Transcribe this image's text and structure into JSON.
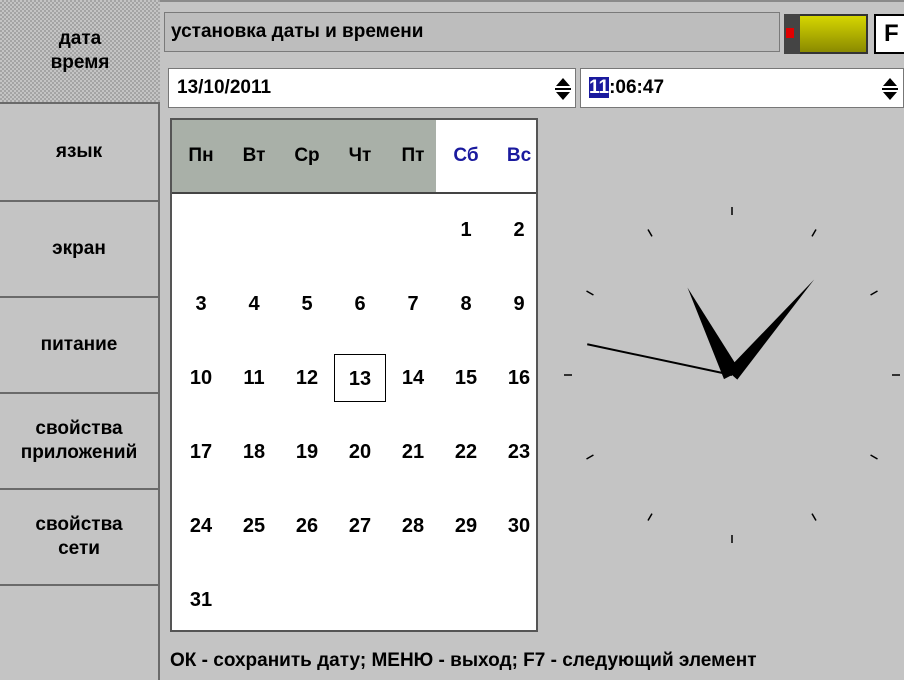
{
  "sidebar": {
    "items": [
      {
        "lines": [
          "дата",
          "время"
        ],
        "active": true
      },
      {
        "lines": [
          "язык"
        ]
      },
      {
        "lines": [
          "экран"
        ]
      },
      {
        "lines": [
          "питание"
        ]
      },
      {
        "lines": [
          "свойства",
          "приложений"
        ]
      },
      {
        "lines": [
          "свойства",
          "сети"
        ]
      }
    ]
  },
  "header": {
    "title": "установка даты и времени",
    "f_key": "F"
  },
  "date_input": {
    "value": "13/10/2011"
  },
  "time_input": {
    "hour": "11",
    "rest": ":06:47"
  },
  "calendar": {
    "weekdays": [
      "Пн",
      "Вт",
      "Ср",
      "Чт",
      "Пт",
      "Сб",
      "Вс"
    ],
    "weekend_color": "#1a1a9e",
    "weeks": [
      [
        "",
        "",
        "",
        "",
        "",
        "1",
        "2"
      ],
      [
        "3",
        "4",
        "5",
        "6",
        "7",
        "8",
        "9"
      ],
      [
        "10",
        "11",
        "12",
        "13",
        "14",
        "15",
        "16"
      ],
      [
        "17",
        "18",
        "19",
        "20",
        "21",
        "22",
        "23"
      ],
      [
        "24",
        "25",
        "26",
        "27",
        "28",
        "29",
        "30"
      ],
      [
        "31",
        "",
        "",
        "",
        "",
        "",
        ""
      ]
    ],
    "selected": "13"
  },
  "clock": {
    "hours": 11,
    "minutes": 6,
    "seconds": 47
  },
  "status": {
    "text": "ОК - сохранить дату; МЕНЮ - выход; F7 - следующий элемент"
  },
  "colors": {
    "background": "#c4c4c4",
    "highlight": "#1a1a9e",
    "battery": "#c8c800"
  }
}
